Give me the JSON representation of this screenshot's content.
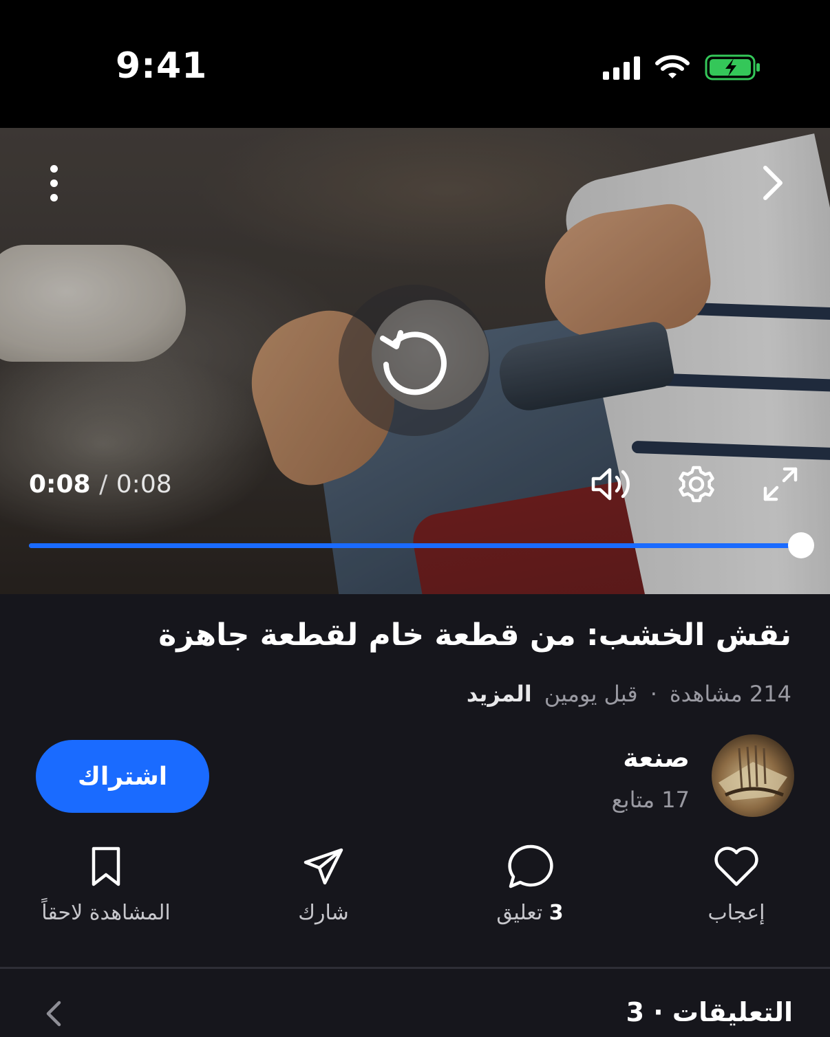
{
  "status_bar": {
    "time": "9:41"
  },
  "player": {
    "elapsed": "0:08",
    "separator": "/",
    "duration": "0:08",
    "progress": 1.0,
    "accent_color": "#1a6bff",
    "icons": {
      "more": "more-vertical-icon",
      "next": "chevron-right-icon",
      "replay": "replay-icon",
      "volume": "volume-icon",
      "settings": "gear-icon",
      "fullscreen": "fullscreen-icon"
    }
  },
  "video": {
    "title": "نقش الخشب: من قطعة خام لقطعة جاهزة",
    "views": "214 مشاهدة",
    "dot": "·",
    "age": "قبل يومين",
    "more_label": "المزيد"
  },
  "channel": {
    "name": "صنعة",
    "followers": "17 متابع",
    "subscribe_label": "اشتراك"
  },
  "actions": {
    "like_label": "إعجاب",
    "comment_count": "3",
    "comment_label": "تعليق",
    "share_label": "شارك",
    "watch_later_label": "المشاهدة لاحقاً"
  },
  "comments": {
    "header": "التعليقات · 3"
  }
}
